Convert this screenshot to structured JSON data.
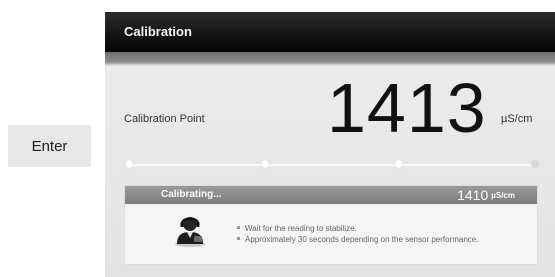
{
  "enter_button": {
    "label": "Enter"
  },
  "window": {
    "title": "Calibration"
  },
  "calibration": {
    "point_label": "Calibration Point",
    "point_value": "1413",
    "unit": "µS/cm"
  },
  "progress": {
    "steps_total": 4,
    "current_step": 3
  },
  "status": {
    "text": "Calibrating...",
    "reading_value": "1410",
    "reading_unit": "µS/cm",
    "icon": "user-headset-icon",
    "hints": [
      "Wait for the reading to stabilize.",
      "Approximately 30 seconds depending on the sensor performance."
    ]
  }
}
